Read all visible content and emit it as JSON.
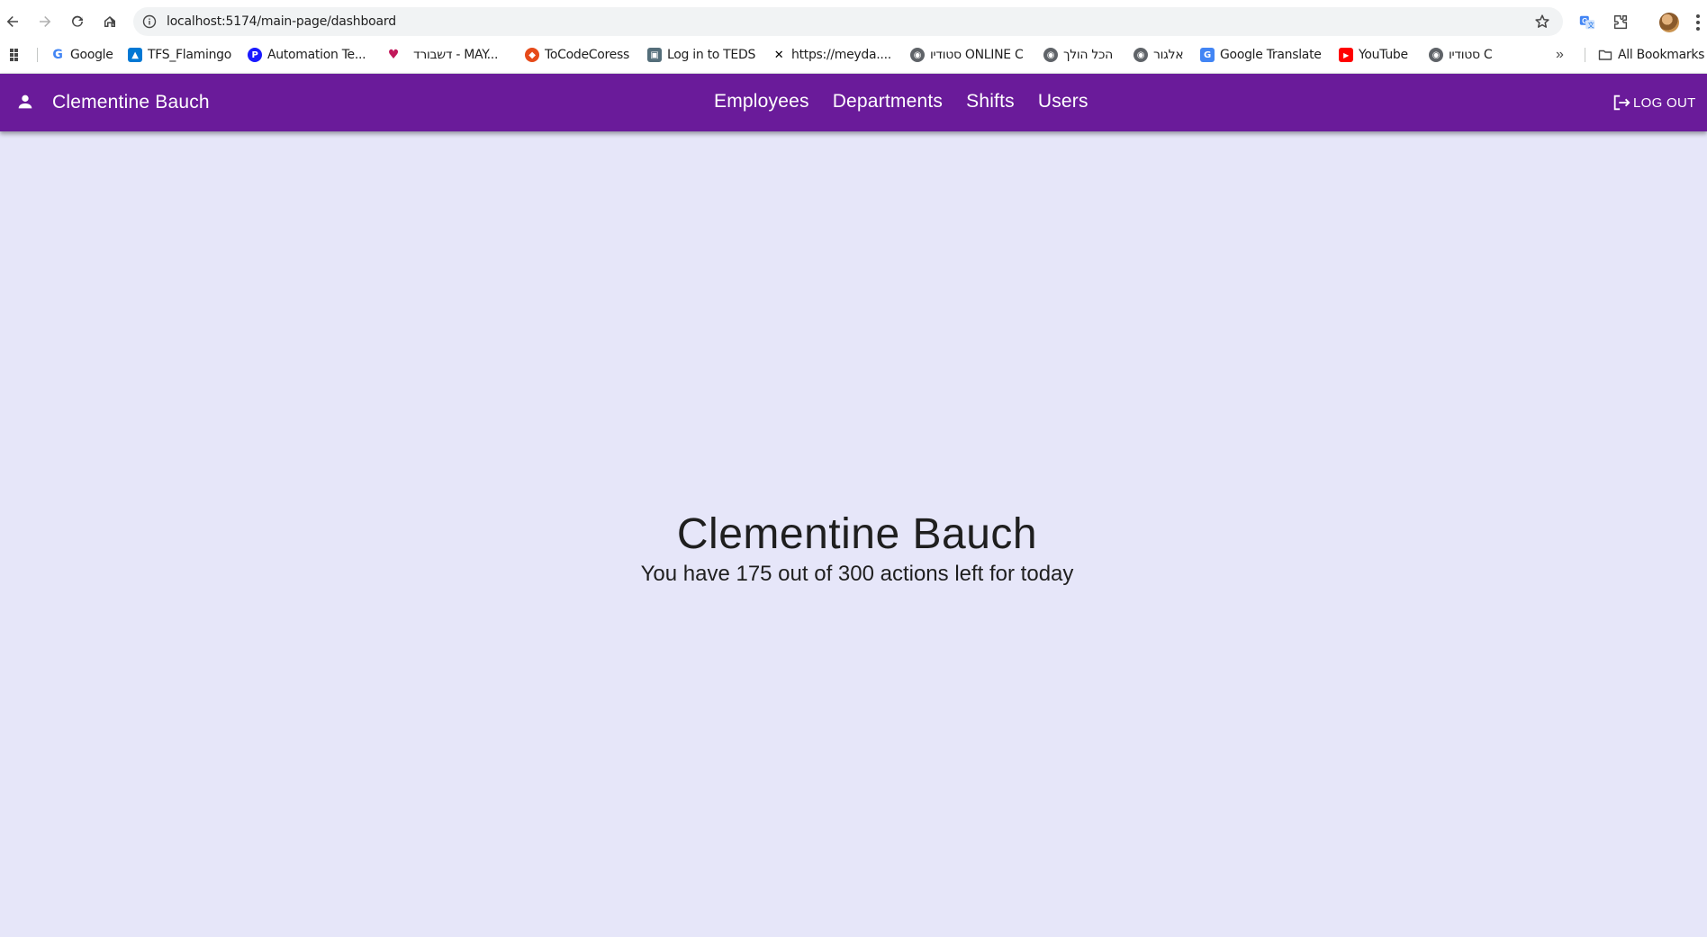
{
  "browser": {
    "url": "localhost:5174/main-page/dashboard",
    "bookmarks": [
      {
        "label": "Google",
        "icon": "google-icon",
        "color": "#4285f4"
      },
      {
        "label": "TFS_Flamingo",
        "icon": "azure-devops-icon",
        "color": "#0078d4"
      },
      {
        "label": "Automation Te...",
        "icon": "p-icon",
        "color": "#1a1aff"
      },
      {
        "label": "דשבורד - MAY...",
        "icon": "heart-icon",
        "color": "#c2185b"
      },
      {
        "label": "ToCodeCoress",
        "icon": "tocode-icon",
        "color": "#e64a19"
      },
      {
        "label": "Log in to TEDS",
        "icon": "teds-icon",
        "color": "#546e7a"
      },
      {
        "label": "https://meyda....",
        "icon": "x-icon",
        "color": "#000000"
      },
      {
        "label": "סטודיו ONLINE C",
        "icon": "globe-icon",
        "color": "#5f6368"
      },
      {
        "label": "הכל הולך",
        "icon": "globe-icon",
        "color": "#5f6368"
      },
      {
        "label": "אלגור",
        "icon": "globe-icon",
        "color": "#5f6368"
      },
      {
        "label": "Google Translate",
        "icon": "translate-icon",
        "color": "#4285f4"
      },
      {
        "label": "YouTube",
        "icon": "youtube-icon",
        "color": "#ff0000"
      },
      {
        "label": "סטודיו C",
        "icon": "globe-icon",
        "color": "#5f6368"
      }
    ],
    "all_bookmarks_label": "All Bookmarks"
  },
  "appbar": {
    "user_name": "Clementine Bauch",
    "nav": [
      "Employees",
      "Departments",
      "Shifts",
      "Users"
    ],
    "logout_label": "LOG OUT",
    "color": "#6a1b9a"
  },
  "dashboard": {
    "title": "Clementine Bauch",
    "subtitle": "You have 175 out of 300 actions left for today"
  }
}
